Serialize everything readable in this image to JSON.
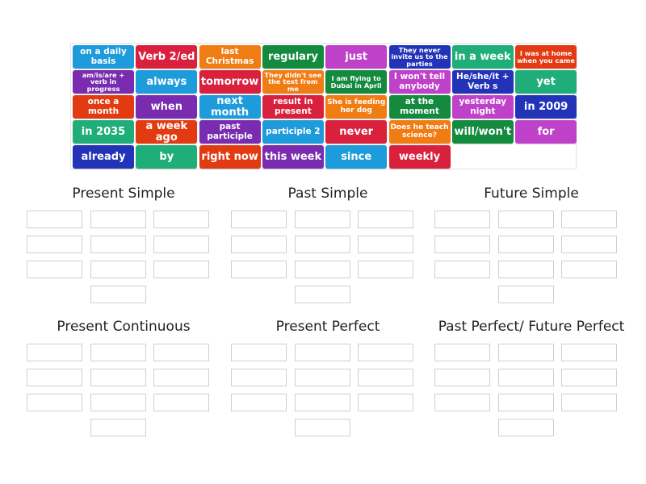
{
  "tiles": [
    {
      "label": "on a daily basis",
      "color": "#1e9bdb"
    },
    {
      "label": "Verb 2/ed",
      "color": "#d9203c"
    },
    {
      "label": "last Christmas",
      "color": "#f07c14"
    },
    {
      "label": "regulary",
      "color": "#138a3e"
    },
    {
      "label": "just",
      "color": "#c041c9"
    },
    {
      "label": "They never invite us to the parties",
      "color": "#2233b8"
    },
    {
      "label": "in a week",
      "color": "#1fae7a"
    },
    {
      "label": "I was at home when you came",
      "color": "#e23b12"
    },
    {
      "label": "am/is/are + verb in progress",
      "color": "#7a2cb0"
    },
    {
      "label": "always",
      "color": "#1e9bdb"
    },
    {
      "label": "tomorrow",
      "color": "#d9203c"
    },
    {
      "label": "They didn't see the text from me",
      "color": "#f07c14"
    },
    {
      "label": "I am flying to Dubai in April",
      "color": "#138a3e"
    },
    {
      "label": "I won't tell anybody",
      "color": "#c041c9"
    },
    {
      "label": "He/she/it + Verb s",
      "color": "#2233b8"
    },
    {
      "label": "yet",
      "color": "#1fae7a"
    },
    {
      "label": "once a month",
      "color": "#e23b12"
    },
    {
      "label": "when",
      "color": "#7a2cb0"
    },
    {
      "label": "next month",
      "color": "#1e9bdb"
    },
    {
      "label": "result in present",
      "color": "#d9203c"
    },
    {
      "label": "She is feeding her dog",
      "color": "#f07c14"
    },
    {
      "label": "at the moment",
      "color": "#138a3e"
    },
    {
      "label": "yesterday night",
      "color": "#c041c9"
    },
    {
      "label": "in 2009",
      "color": "#2233b8"
    },
    {
      "label": "in 2035",
      "color": "#1fae7a"
    },
    {
      "label": "a week ago",
      "color": "#e23b12"
    },
    {
      "label": "past participle",
      "color": "#7a2cb0"
    },
    {
      "label": "participle 2",
      "color": "#1e9bdb"
    },
    {
      "label": "never",
      "color": "#d9203c"
    },
    {
      "label": "Does he teach science?",
      "color": "#f07c14"
    },
    {
      "label": "will/won't",
      "color": "#138a3e"
    },
    {
      "label": "for",
      "color": "#c041c9"
    },
    {
      "label": "already",
      "color": "#2233b8"
    },
    {
      "label": "by",
      "color": "#1fae7a"
    },
    {
      "label": "right now",
      "color": "#e23b12"
    },
    {
      "label": "this week",
      "color": "#7a2cb0"
    },
    {
      "label": "since",
      "color": "#1e9bdb"
    },
    {
      "label": "weekly",
      "color": "#d9203c"
    }
  ],
  "groups": [
    {
      "title": "Present Simple",
      "slots": 10
    },
    {
      "title": "Past Simple",
      "slots": 10
    },
    {
      "title": "Future Simple",
      "slots": 10
    },
    {
      "title": "Present Continuous",
      "slots": 10
    },
    {
      "title": "Present Perfect",
      "slots": 10
    },
    {
      "title": "Past Perfect/ Future Perfect",
      "slots": 10
    }
  ]
}
